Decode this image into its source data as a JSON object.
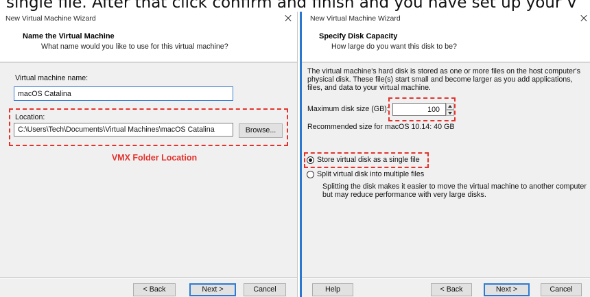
{
  "caption": {
    "text": "single file. After that click confirm and finish and you have set up your V"
  },
  "left_dialog": {
    "title": "New Virtual Machine Wizard",
    "header_title": "Name the Virtual Machine",
    "header_subtitle": "What name would you like to use for this virtual machine?",
    "name_label": "Virtual machine name:",
    "name_value": "macOS Catalina",
    "location_label": "Location:",
    "location_value": "C:\\Users\\Tech\\Documents\\Virtual Machines\\macOS Catalina",
    "browse_label": "Browse...",
    "annotation": "VMX Folder Location",
    "buttons": {
      "back": "< Back",
      "next": "Next >",
      "cancel": "Cancel"
    }
  },
  "right_dialog": {
    "title": "New Virtual Machine Wizard",
    "header_title": "Specify Disk Capacity",
    "header_subtitle": "How large do you want this disk to be?",
    "description_lines": [
      "The virtual machine's hard disk is stored as one or more files on the host computer's",
      "physical disk. These file(s) start small and become larger as you add applications,",
      "files, and data to your virtual machine."
    ],
    "max_size_label": "Maximum disk size (GB):",
    "max_size_value": "100",
    "recommended": "Recommended size for macOS 10.14: 40 GB",
    "disk_options": [
      {
        "label": "Store virtual disk as a single file",
        "selected": true
      },
      {
        "label": "Split virtual disk into multiple files",
        "selected": false
      }
    ],
    "split_note_lines": [
      "Splitting the disk makes it easier to move the virtual machine to another computer",
      "but may reduce performance with very large disks."
    ],
    "buttons": {
      "help": "Help",
      "back": "< Back",
      "next": "Next >",
      "cancel": "Cancel"
    }
  },
  "icons": {
    "close": "close-icon",
    "spin_up": "chevron-up-icon",
    "spin_down": "chevron-down-icon",
    "radio": "radio-icon"
  },
  "colors": {
    "accent_blue": "#2b78d3",
    "annotation_red": "#e3322b",
    "dialog_background": "#f0f0f0"
  }
}
